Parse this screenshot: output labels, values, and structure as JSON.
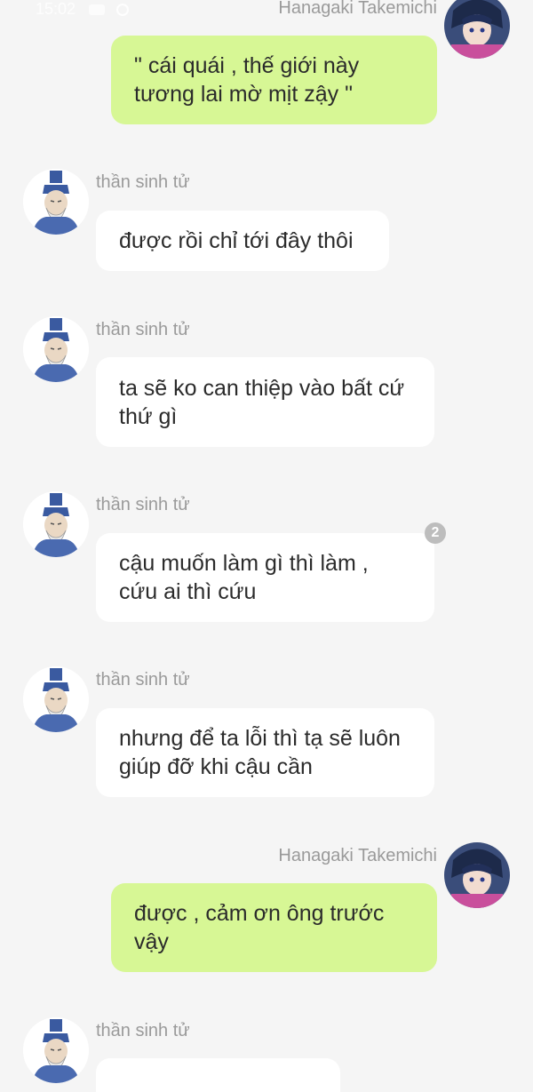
{
  "status_bar": {
    "time": "15:02"
  },
  "contacts": {
    "me": "Hanagaki Takemichi",
    "god": "thần sinh tử"
  },
  "messages": [
    {
      "sender": "Hanagaki Takemichi",
      "text": "\" cái quái , thế giới này tương lai mờ mịt zậy \""
    },
    {
      "sender": "thần sinh tử",
      "text": "được rồi chỉ tới đây thôi"
    },
    {
      "sender": "thần sinh tử",
      "text": "ta sẽ ko can thiệp vào bất cứ thứ gì"
    },
    {
      "sender": "thần sinh tử",
      "text": "cậu muốn làm gì thì làm , cứu ai thì cứu",
      "badge": "2"
    },
    {
      "sender": "thần sinh tử",
      "text": "nhưng để ta lỗi thì tạ sẽ luôn giúp đỡ khi cậu cần"
    },
    {
      "sender": "Hanagaki Takemichi",
      "text": "được , cảm ơn ông trước vậy"
    },
    {
      "sender": "thần sinh tử",
      "text": ""
    }
  ],
  "colors": {
    "background": "#f5f5f5",
    "incoming_bubble": "#ffffff",
    "outgoing_bubble": "#d7f795",
    "name_text": "#9a9a9a"
  }
}
